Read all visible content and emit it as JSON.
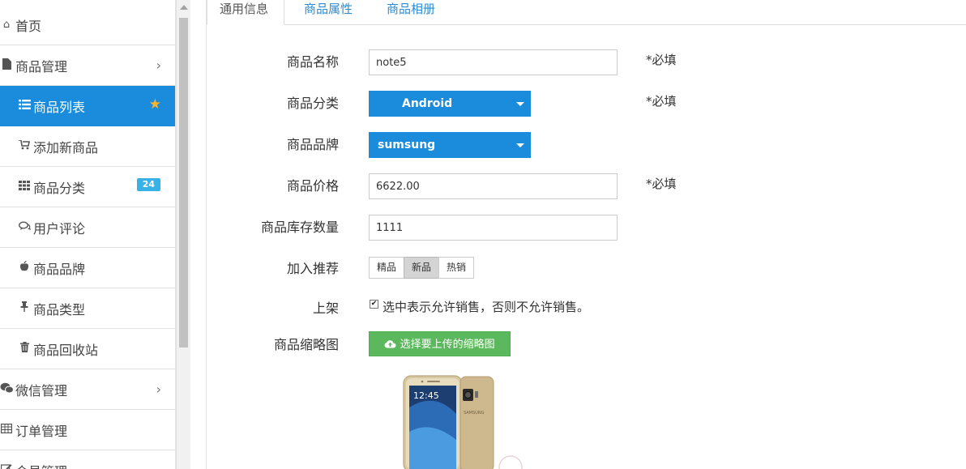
{
  "sidebar": {
    "items": [
      {
        "label": "首页",
        "icon": "home-icon"
      },
      {
        "label": "商品管理",
        "icon": "file-icon"
      },
      {
        "label": "商品列表",
        "icon": "list-icon"
      },
      {
        "label": "添加新商品",
        "icon": "cart-add-icon"
      },
      {
        "label": "商品分类",
        "icon": "grid-icon",
        "badge": "24"
      },
      {
        "label": "用户评论",
        "icon": "comment-icon"
      },
      {
        "label": "商品品牌",
        "icon": "apple-icon"
      },
      {
        "label": "商品类型",
        "icon": "pin-icon"
      },
      {
        "label": "商品回收站",
        "icon": "trash-icon"
      },
      {
        "label": "微信管理",
        "icon": "wechat-icon"
      },
      {
        "label": "订单管理",
        "icon": "table-icon"
      },
      {
        "label": "会员管理",
        "icon": "edit-icon"
      }
    ],
    "active_color": "#1a8cdb"
  },
  "tabs": [
    "通用信息",
    "商品属性",
    "商品相册"
  ],
  "form": {
    "name_label": "商品名称",
    "name_value": "note5",
    "category_label": "商品分类",
    "category_value": "Android",
    "brand_label": "商品品牌",
    "brand_value": "sumsung",
    "price_label": "商品价格",
    "price_value": "6622.00",
    "stock_label": "商品库存数量",
    "stock_value": "1111",
    "recommend_label": "加入推荐",
    "recommend_options": [
      "精品",
      "新品",
      "热销"
    ],
    "recommend_selected": "新品",
    "onsale_label": "上架",
    "onsale_text": "选中表示允许销售，否则不允许销售。",
    "onsale_checked": true,
    "thumb_label": "商品缩略图",
    "upload_label": "选择要上传的缩略图",
    "required_text": "*必填"
  },
  "thumbnail": {
    "time_text": "12:45",
    "brand_text": "SAMSUNG"
  },
  "colors": {
    "primary": "#1a8cdb",
    "success": "#5cb85c",
    "badge": "#37b2e8",
    "star": "#f5b52e"
  }
}
